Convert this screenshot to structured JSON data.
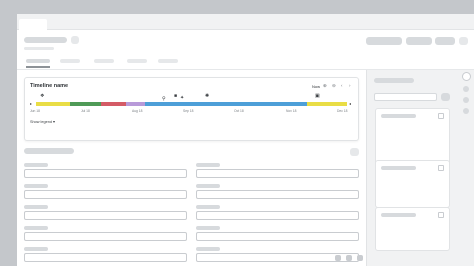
{
  "timeline": {
    "title": "Timeline name",
    "now_label": "Now",
    "tools": {
      "zoom_in": "⊕",
      "zoom_out": "⊖",
      "prev": "‹",
      "next": "›"
    },
    "start_date": "Jun 18",
    "dates": [
      "Jul 18",
      "Aug 18",
      "Sep 18",
      "Oct 18",
      "Nov 18",
      "Dec 18"
    ],
    "end_marker": "◂",
    "start_marker": "▸",
    "legend_toggle": "Show legend ▾",
    "segments": [
      {
        "color": "#e9dd45",
        "share": 0.11
      },
      {
        "color": "#4f9a57",
        "share": 0.1
      },
      {
        "color": "#d45b66",
        "share": 0.08
      },
      {
        "color": "#b89ad9",
        "share": 0.06
      },
      {
        "color": "#4d9fd8",
        "share": 0.52
      },
      {
        "color": "#e9dd45",
        "share": 0.13
      }
    ],
    "markers": [
      {
        "icon": "❖",
        "name": "milestone-icon"
      },
      {
        "icon": "⚲",
        "name": "pin-icon"
      },
      {
        "icon": "■",
        "name": "square-marker-icon"
      },
      {
        "icon": "✦",
        "name": "star-marker-icon"
      },
      {
        "icon": "✺",
        "name": "burst-marker-icon"
      },
      {
        "icon": "▣",
        "name": "box-marker-icon"
      }
    ]
  }
}
